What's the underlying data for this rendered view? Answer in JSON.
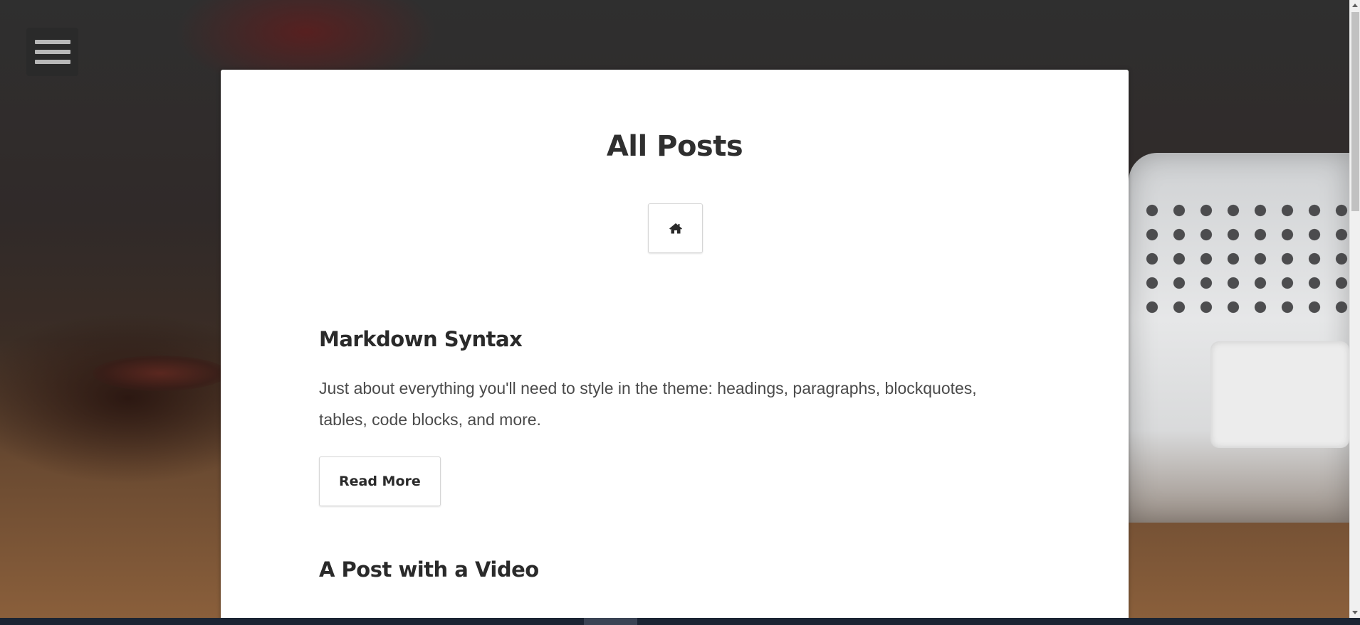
{
  "page": {
    "title": "All Posts"
  },
  "nav": {
    "menu_icon": "hamburger-menu-icon",
    "home_icon": "home-icon"
  },
  "posts": [
    {
      "title": "Markdown Syntax",
      "excerpt": "Just about everything you'll need to style in the theme: headings, paragraphs, blockquotes, tables, code blocks, and more.",
      "read_more_label": "Read More"
    },
    {
      "title": "A Post with a Video"
    }
  ],
  "colors": {
    "card_background": "#ffffff",
    "title_text": "#2f2f2f",
    "body_text": "#4a4a4a",
    "menu_button_bg": "#2a2a2a",
    "menu_bars": "#b8b8b8"
  }
}
